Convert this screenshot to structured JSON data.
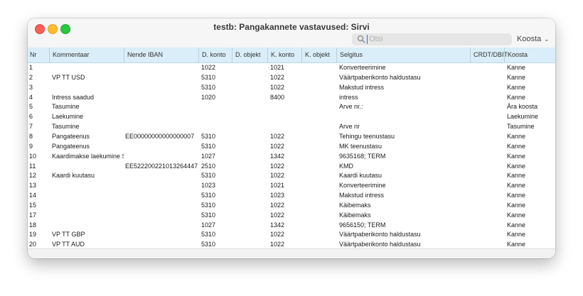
{
  "window": {
    "title": "testb: Pangakannete vastavused: Sirvi",
    "search_placeholder": "Otsi",
    "koosta_label": "Koosta"
  },
  "table": {
    "columns": [
      "Nr",
      "Kommentaar",
      "Nende IBAN",
      "D. konto",
      "D. objekt",
      "K. konto",
      "K. objekt",
      "Selgitus",
      "CRDT/DBIT",
      "Koosta"
    ],
    "rows": [
      [
        "1",
        "",
        "",
        "1022",
        "",
        "1021",
        "",
        "Konverteerimine",
        "",
        "Kanne"
      ],
      [
        "2",
        "VP TT USD",
        "",
        "5310",
        "",
        "1022",
        "",
        "Väärtpaberikonto haldustasu",
        "",
        "Kanne"
      ],
      [
        "3",
        "",
        "",
        "5310",
        "",
        "1022",
        "",
        "Makstud intress",
        "",
        "Kanne"
      ],
      [
        "4",
        "Intress saadud",
        "",
        "1020",
        "",
        "8400",
        "",
        "intress",
        "",
        "Kanne"
      ],
      [
        "5",
        "Tasumine",
        "",
        "",
        "",
        "",
        "",
        "Arve nr.:",
        "",
        "Ära koosta"
      ],
      [
        "6",
        "Laekumine",
        "",
        "",
        "",
        "",
        "",
        "",
        "",
        "Laekumine"
      ],
      [
        "7",
        "Tasumine",
        "",
        "",
        "",
        "",
        "",
        "Arve nr",
        "",
        "Tasumine"
      ],
      [
        "8",
        "Pangateenus",
        "EE00000000000000007",
        "5310",
        "",
        "1022",
        "",
        "Tehingu teenustasu",
        "",
        "Kanne"
      ],
      [
        "9",
        "Pangateenus",
        "",
        "5310",
        "",
        "1022",
        "",
        "MK teenustasu",
        "",
        "Kanne"
      ],
      [
        "10",
        "Kaardimakse laekumine S...",
        "",
        "1027",
        "",
        "1342",
        "",
        "9635168; TERM",
        "",
        "Kanne"
      ],
      [
        "11",
        "",
        "EE522200221013264447",
        "2510",
        "",
        "1022",
        "",
        "KMD",
        "",
        "Kanne"
      ],
      [
        "12",
        "Kaardi kuutasu",
        "",
        "5310",
        "",
        "1022",
        "",
        "Kaardi kuutasu",
        "",
        "Kanne"
      ],
      [
        "13",
        "",
        "",
        "1023",
        "",
        "1021",
        "",
        "Konverteerimine",
        "",
        "Kanne"
      ],
      [
        "14",
        "",
        "",
        "5310",
        "",
        "1023",
        "",
        "Makstud intress",
        "",
        "Kanne"
      ],
      [
        "15",
        "",
        "",
        "5310",
        "",
        "1022",
        "",
        "Käibemaks",
        "",
        "Kanne"
      ],
      [
        "17",
        "",
        "",
        "5310",
        "",
        "1022",
        "",
        "Käibemaks",
        "",
        "Kanne"
      ],
      [
        "18",
        "",
        "",
        "1027",
        "",
        "1342",
        "",
        "9656150; TERM",
        "",
        "Kanne"
      ],
      [
        "19",
        "VP TT GBP",
        "",
        "5310",
        "",
        "1022",
        "",
        "Väärtpaberikonto haldustasu",
        "",
        "Kanne"
      ],
      [
        "20",
        "VP TT AUD",
        "",
        "5310",
        "",
        "1022",
        "",
        "Väärtpaberikonto haldustasu",
        "",
        "Kanne"
      ]
    ]
  },
  "colors": {
    "header_bg": "#d9eef8",
    "close": "#fe5f57",
    "minimize": "#febc2e",
    "maximize": "#28c840"
  },
  "icons": [
    "close-icon",
    "minimize-icon",
    "maximize-icon",
    "search-icon",
    "chevron-down-icon"
  ]
}
